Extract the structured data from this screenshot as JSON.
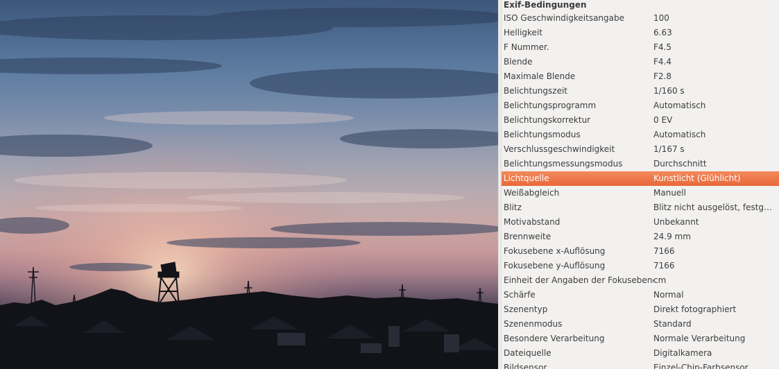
{
  "photo": {
    "subject": "sunset-sky-with-tower-silhouette"
  },
  "panel": {
    "section_title": "Exif-Bedingungen",
    "selected_index": 11,
    "highlight_color": "#ec7446",
    "rows": [
      {
        "key": "ISO Geschwindigkeitsangabe",
        "value": "100"
      },
      {
        "key": "Helligkeit",
        "value": "6.63"
      },
      {
        "key": "F Nummer.",
        "value": "F4.5"
      },
      {
        "key": "Blende",
        "value": "F4.4"
      },
      {
        "key": "Maximale Blende",
        "value": "F2.8"
      },
      {
        "key": "Belichtungszeit",
        "value": "1/160 s"
      },
      {
        "key": "Belichtungsprogramm",
        "value": "Automatisch"
      },
      {
        "key": "Belichtungskorrektur",
        "value": "0 EV"
      },
      {
        "key": "Belichtungsmodus",
        "value": "Automatisch"
      },
      {
        "key": "Verschlussgeschwindigkeit",
        "value": "1/167 s"
      },
      {
        "key": "Belichtungsmessungsmodus",
        "value": "Durchschnitt"
      },
      {
        "key": "Lichtquelle",
        "value": "Kunstlicht (Glühlicht)"
      },
      {
        "key": "Weißabgleich",
        "value": "Manuell"
      },
      {
        "key": "Blitz",
        "value": "Blitz nicht ausgelöst, festgel…"
      },
      {
        "key": "Motivabstand",
        "value": "Unbekannt"
      },
      {
        "key": "Brennweite",
        "value": "24.9 mm"
      },
      {
        "key": "Fokusebene x-Auflösung",
        "value": "7166"
      },
      {
        "key": "Fokusebene y-Auflösung",
        "value": "7166"
      },
      {
        "key": "Einheit der Angaben der Fokusebene",
        "value": "cm"
      },
      {
        "key": "Schärfe",
        "value": "Normal"
      },
      {
        "key": "Szenentyp",
        "value": "Direkt fotographiert"
      },
      {
        "key": "Szenenmodus",
        "value": "Standard"
      },
      {
        "key": "Besondere Verarbeitung",
        "value": "Normale Verarbeitung"
      },
      {
        "key": "Dateiquelle",
        "value": "Digitalkamera"
      },
      {
        "key": "Bildsensor",
        "value": "Einzel-Chip-Farbsensor"
      }
    ]
  }
}
